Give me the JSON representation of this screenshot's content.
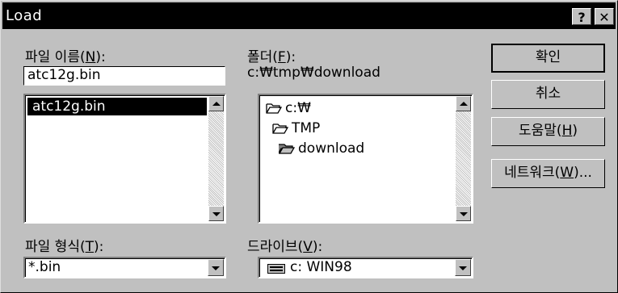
{
  "window": {
    "title": "Load",
    "help_label": "?",
    "close_label": "✕"
  },
  "filename": {
    "label": "파일 이름(",
    "mnemonic": "N",
    "label_end": "):",
    "value": "atc12g.bin",
    "files": [
      "atc12g.bin"
    ]
  },
  "folders": {
    "label": "폴더(",
    "mnemonic": "F",
    "label_end": "):",
    "current_path": "c:₩tmp₩download",
    "tree": [
      "c:₩",
      "TMP",
      "download"
    ]
  },
  "filetype": {
    "label": "파일 형식(",
    "mnemonic": "T",
    "label_end": "):",
    "value": "*.bin"
  },
  "drive": {
    "label": "드라이브(",
    "mnemonic": "V",
    "label_end": "):",
    "value": "c: WIN98"
  },
  "buttons": {
    "ok": "확인",
    "cancel": "취소",
    "help": "도움말(",
    "help_mnemonic": "H",
    "help_end": ")",
    "network": "네트워크(",
    "network_mnemonic": "W",
    "network_end": ")..."
  }
}
